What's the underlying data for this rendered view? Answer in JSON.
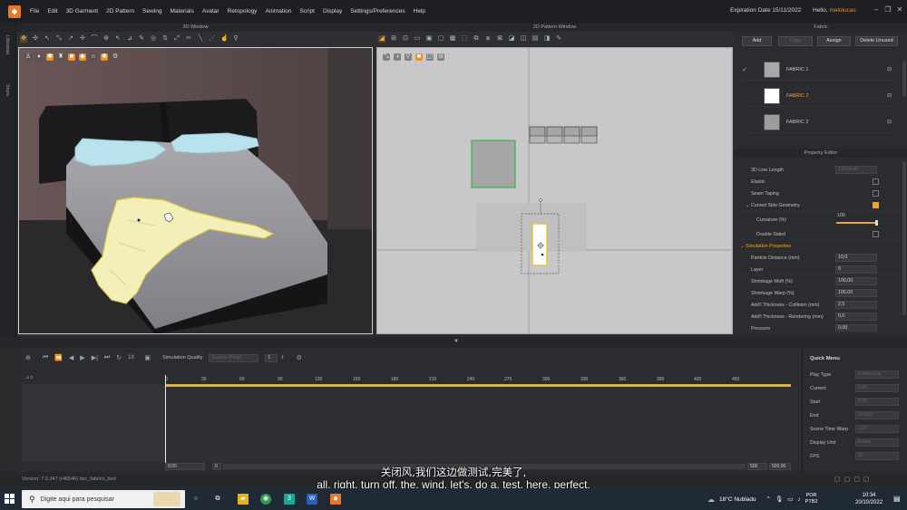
{
  "menubar": {
    "items": [
      "File",
      "Edit",
      "3D Garment",
      "2D Pattern",
      "Sewing",
      "Materials",
      "Avatar",
      "Retopology",
      "Animation",
      "Script",
      "Display",
      "Settings/Preferences",
      "Help"
    ],
    "expiration": "Expiration Date 15/11/2022",
    "hello_prefix": "Hello, ",
    "username": "melolucas"
  },
  "sidebar": {
    "tabs": [
      "Librarian",
      "Store"
    ]
  },
  "windows": {
    "window3d_title": "3D Window",
    "window2d_title": "2D Pattern Window",
    "fabric_title": "Fabric",
    "property_title": "Property Editor"
  },
  "fabric": {
    "buttons": {
      "add": "Add",
      "copy": "Copy",
      "assign": "Assign",
      "delete_unused": "Delete Unused"
    },
    "items": [
      {
        "name": "FABRIC 1",
        "selected": false,
        "checked": true,
        "color": "#a8a8a8"
      },
      {
        "name": "FABRIC 2",
        "selected": true,
        "checked": false,
        "color": "#ffffff"
      },
      {
        "name": "FABRIC 2",
        "selected": false,
        "checked": false,
        "color": "#9c9c9c"
      }
    ]
  },
  "property_editor": {
    "rows": [
      {
        "label": "3D Line Length",
        "value": "179.9mm",
        "kind": "value-dim"
      },
      {
        "label": "Elastic",
        "kind": "checkbox",
        "checked": false
      },
      {
        "label": "Seam Taping",
        "kind": "checkbox",
        "checked": false
      },
      {
        "label": "Curved Side Geometry",
        "kind": "checkbox",
        "checked": true
      },
      {
        "label": "Curvature (%)",
        "value": "100",
        "kind": "slider"
      },
      {
        "label": "Double Sided",
        "kind": "checkbox",
        "checked": false
      },
      {
        "label": "Simulation Properties",
        "kind": "section"
      },
      {
        "label": "Particle Distance (mm)",
        "value": "10,0",
        "kind": "value"
      },
      {
        "label": "Layer",
        "value": "0",
        "kind": "value"
      },
      {
        "label": "Shrinkage Weft (%)",
        "value": "100,00",
        "kind": "value"
      },
      {
        "label": "Shrinkage Warp (%)",
        "value": "100,00",
        "kind": "value"
      },
      {
        "label": "Add'l Thickness - Collision (mm)",
        "value": "2,5",
        "kind": "value"
      },
      {
        "label": "Add'l Thickness - Rendering (mm)",
        "value": "0,0",
        "kind": "value"
      },
      {
        "label": "Pressure",
        "value": "0,00",
        "kind": "value"
      }
    ]
  },
  "timeline": {
    "simulation_quality_label": "Simulation Quality",
    "simulation_quality_value": "Custom (Final)",
    "speed_label": "1X",
    "sim_count": "1",
    "ticks": [
      "0",
      "30",
      "60",
      "90",
      "120",
      "150",
      "180",
      "210",
      "240",
      "270",
      "300",
      "330",
      "360",
      "390",
      "420",
      "450"
    ],
    "start_value": "0,00",
    "frame_value": "0",
    "end_frame": "500",
    "end_value": "500,00"
  },
  "quick_menu": {
    "title": "Quick Menu",
    "rows": [
      {
        "label": "Play Type",
        "value": "Continuous"
      },
      {
        "label": "Current",
        "value": "0,00"
      },
      {
        "label": "Start",
        "value": "0,00"
      },
      {
        "label": "End",
        "value": "500,00"
      },
      {
        "label": "Scene Time Warp",
        "value": "1,00"
      },
      {
        "label": "Display Unit",
        "value": "Frame"
      },
      {
        "label": "FPS",
        "value": "30"
      }
    ]
  },
  "status": {
    "version": "Version:  7.0.347 (r46546)     dvc_fabrics_bed"
  },
  "subtitles": {
    "chinese": "关闭风,我们这边做测试,完美了,",
    "english": "all, right, turn off, the, wind, let's, do a, test, here, perfect,"
  },
  "taskbar": {
    "search_placeholder": "Digite aqui para pesquisar",
    "weather": "18°C  Nublado",
    "lang_top": "POR",
    "lang_bottom": "PTB2",
    "time": "10:34",
    "date": "20/10/2022"
  },
  "colors": {
    "accent": "#e8a838",
    "selected_outline": "#3bb34a",
    "cloth": "#f3efb8",
    "pillow": "#b8e2ec"
  }
}
